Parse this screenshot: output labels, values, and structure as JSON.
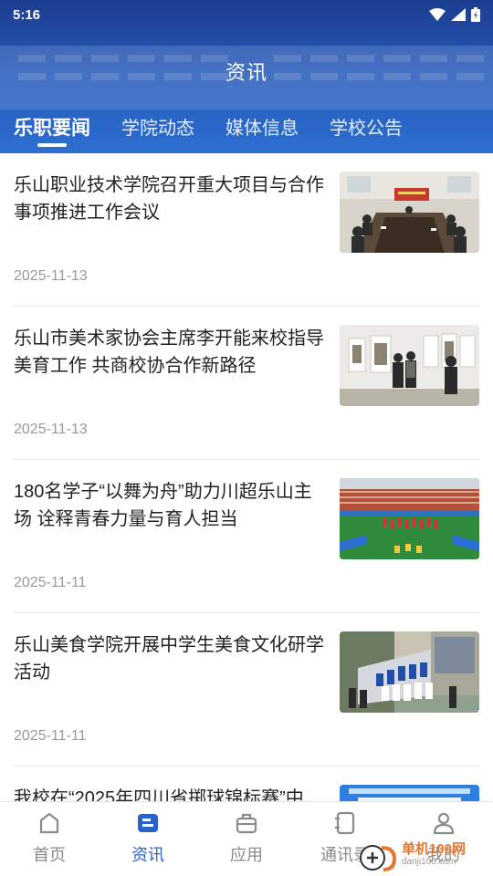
{
  "status_bar": {
    "time": "5:16"
  },
  "header": {
    "title": "资讯",
    "tabs": [
      {
        "label": "乐职要闻",
        "active": true
      },
      {
        "label": "学院动态",
        "active": false
      },
      {
        "label": "媒体信息",
        "active": false
      },
      {
        "label": "学校公告",
        "active": false
      }
    ]
  },
  "news": [
    {
      "title": "乐山职业技术学院召开重大项目与合作事项推进工作会议",
      "date": "2025-11-13",
      "image": "meeting-photo"
    },
    {
      "title": "乐山市美术家协会主席李开能来校指导美育工作 共商校协合作新路径",
      "date": "2025-11-13",
      "image": "gallery-photo"
    },
    {
      "title": "180名学子“以舞为舟”助力川超乐山主场  诠释青春力量与育人担当",
      "date": "2025-11-11",
      "image": "stadium-photo"
    },
    {
      "title": "乐山美食学院开展中学生美食文化研学活动",
      "date": "2025-11-11",
      "image": "group-photo"
    },
    {
      "title": "我校在“2025年四川省掷球锦标赛”中",
      "date": "",
      "image": "banner-photo"
    }
  ],
  "tabbar": [
    {
      "label": "首页",
      "icon": "home-icon",
      "active": false
    },
    {
      "label": "资讯",
      "icon": "news-icon",
      "active": true
    },
    {
      "label": "应用",
      "icon": "briefcase-icon",
      "active": false
    },
    {
      "label": "通讯录",
      "icon": "contacts-icon",
      "active": false
    },
    {
      "label": "我的",
      "icon": "profile-icon",
      "active": false
    }
  ],
  "watermark": {
    "line1": "单机100网",
    "line2": "danji100.com"
  },
  "colors": {
    "primary": "#2b62c9",
    "header_dark": "#1c3d8f",
    "inactive": "#8a8a8a"
  }
}
